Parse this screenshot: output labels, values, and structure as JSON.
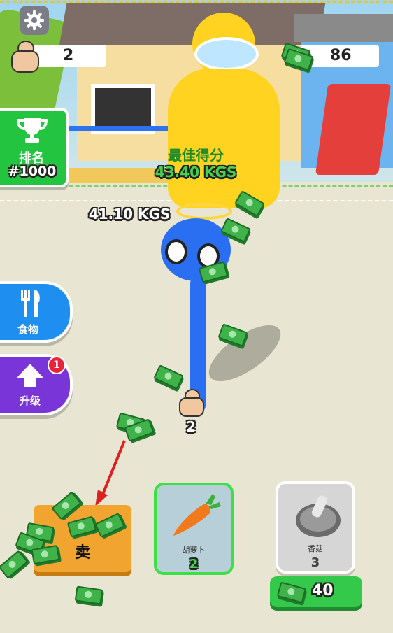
{
  "settings": {
    "icon": "gear-icon"
  },
  "player_count": {
    "icon": "muscle-man-icon",
    "value": "2"
  },
  "money": {
    "icon": "cash-stack-icon",
    "value": "86"
  },
  "ranking": {
    "icon": "trophy-icon",
    "label": "排名",
    "rank": "#1000"
  },
  "best_score": {
    "label": "最佳得分",
    "value": "43.40 KGS"
  },
  "current_weight": {
    "value": "41.10 KGS"
  },
  "side_buttons": {
    "food": {
      "icon": "fork-knife-icon",
      "label": "食物"
    },
    "upgrade": {
      "icon": "up-arrow-icon",
      "label": "升级",
      "badge": "1"
    }
  },
  "player": {
    "count_label": "2"
  },
  "sell_station": {
    "label": "卖"
  },
  "food_shop": [
    {
      "name": "胡萝卜",
      "level": "2",
      "icon": "carrot-icon",
      "selected": true
    },
    {
      "name": "香菇",
      "level": "3",
      "icon": "mushroom-icon",
      "selected": false,
      "price": "40"
    }
  ],
  "colors": {
    "accent_green": "#34c94a",
    "blue_button": "#1e8ff0",
    "purple_button": "#7a35d8",
    "sell_orange": "#f2a431"
  }
}
